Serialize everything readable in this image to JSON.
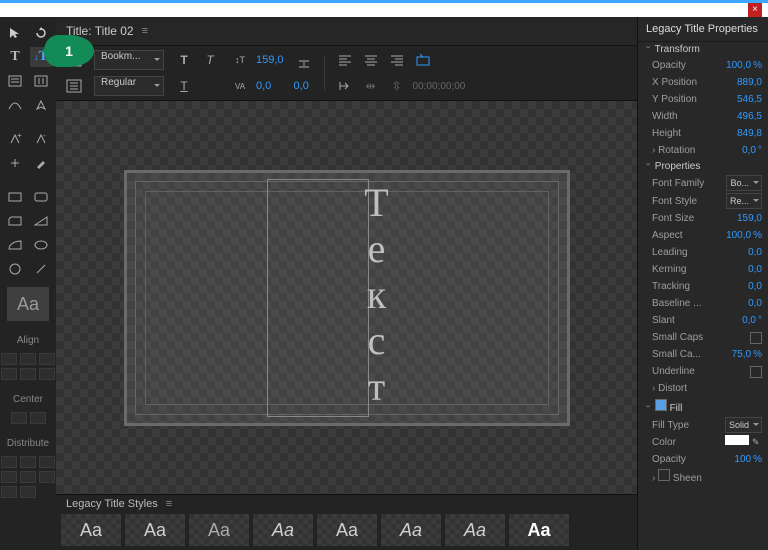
{
  "window": {
    "close": "×"
  },
  "callout": "1",
  "tool_swatch": "Aa",
  "sections": {
    "align": "Align",
    "center": "Center",
    "distribute": "Distribute"
  },
  "title_header": {
    "label": "Title:",
    "name": "Title 02"
  },
  "toolbar": {
    "font_family": "Bookm...",
    "font_style": "Regular",
    "size": "159,0",
    "leading": "0,0",
    "kerning": "0,0",
    "timecode": "00;00;00;00"
  },
  "canvas_text": [
    "Т",
    "е",
    "к",
    "с",
    "т"
  ],
  "styles": {
    "header": "Legacy Title Styles",
    "swatch": "Aa"
  },
  "props": {
    "header": "Legacy Title Properties",
    "sect_transform": "Transform",
    "opacity_l": "Opacity",
    "opacity_v": "100,0",
    "pct": "%",
    "xpos_l": "X Position",
    "xpos_v": "889,0",
    "ypos_l": "Y Position",
    "ypos_v": "546,5",
    "width_l": "Width",
    "width_v": "496,5",
    "height_l": "Height",
    "height_v": "849,8",
    "rotation_l": "Rotation",
    "rotation_v": "0,0",
    "deg": "°",
    "sect_props": "Properties",
    "ff_l": "Font Family",
    "ff_v": "Bo...",
    "fs_l": "Font Style",
    "fs_v": "Re...",
    "fsize_l": "Font Size",
    "fsize_v": "159,0",
    "aspect_l": "Aspect",
    "aspect_v": "100,0",
    "leading_l": "Leading",
    "leading_v": "0,0",
    "kerning_l": "Kerning",
    "kerning_v": "0,0",
    "tracking_l": "Tracking",
    "tracking_v": "0,0",
    "baseline_l": "Baseline ...",
    "baseline_v": "0,0",
    "slant_l": "Slant",
    "slant_v": "0,0",
    "smallcaps_l": "Small Caps",
    "smallcapssz_l": "Small Ca...",
    "smallcapssz_v": "75,0",
    "underline_l": "Underline",
    "distort_l": "Distort",
    "sect_fill": "Fill",
    "filltype_l": "Fill Type",
    "filltype_v": "Solid",
    "color_l": "Color",
    "fopacity_l": "Opacity",
    "fopacity_v": "100",
    "sheen_l": "Sheen"
  }
}
